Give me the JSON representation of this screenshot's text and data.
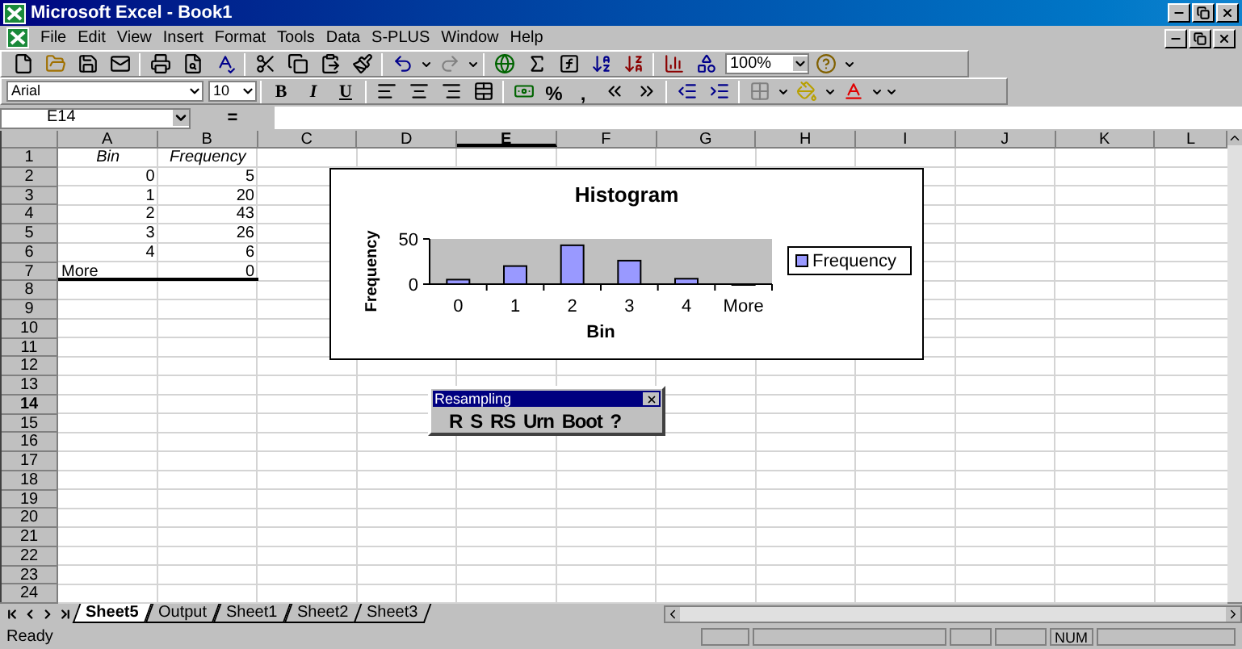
{
  "window": {
    "title": "Microsoft Excel - Book1"
  },
  "menu": [
    {
      "label": "File"
    },
    {
      "label": "Edit"
    },
    {
      "label": "View"
    },
    {
      "label": "Insert"
    },
    {
      "label": "Format"
    },
    {
      "label": "Tools"
    },
    {
      "label": "Data"
    },
    {
      "label": "S-PLUS"
    },
    {
      "label": "Window"
    },
    {
      "label": "Help"
    }
  ],
  "toolbar": {
    "zoom": "100%"
  },
  "format_toolbar": {
    "font": "Arial",
    "size": "10",
    "style_buttons": [
      "B",
      "I",
      "U"
    ],
    "number_buttons": [
      "%",
      ","
    ]
  },
  "formula_bar": {
    "name_box": "E14",
    "equals": "="
  },
  "columns": [
    {
      "label": "A",
      "selected": false
    },
    {
      "label": "B",
      "selected": false
    },
    {
      "label": "C",
      "selected": false
    },
    {
      "label": "D",
      "selected": false
    },
    {
      "label": "E",
      "selected": true
    },
    {
      "label": "F",
      "selected": false
    },
    {
      "label": "G",
      "selected": false
    },
    {
      "label": "H",
      "selected": false
    },
    {
      "label": "I",
      "selected": false
    },
    {
      "label": "J",
      "selected": false
    },
    {
      "label": "K",
      "selected": false
    },
    {
      "label": "L",
      "selected": false
    }
  ],
  "rows": [
    {
      "number": "1",
      "selected": false,
      "underlined": false,
      "cells": [
        {
          "text": "Bin",
          "kind": "label"
        },
        {
          "text": "Frequency",
          "kind": "label"
        }
      ]
    },
    {
      "number": "2",
      "selected": false,
      "underlined": false,
      "cells": [
        {
          "text": "0",
          "kind": "number"
        },
        {
          "text": "5",
          "kind": "number"
        }
      ]
    },
    {
      "number": "3",
      "selected": false,
      "underlined": false,
      "cells": [
        {
          "text": "1",
          "kind": "number"
        },
        {
          "text": "20",
          "kind": "number"
        }
      ]
    },
    {
      "number": "4",
      "selected": false,
      "underlined": false,
      "cells": [
        {
          "text": "2",
          "kind": "number"
        },
        {
          "text": "43",
          "kind": "number"
        }
      ]
    },
    {
      "number": "5",
      "selected": false,
      "underlined": false,
      "cells": [
        {
          "text": "3",
          "kind": "number"
        },
        {
          "text": "26",
          "kind": "number"
        }
      ]
    },
    {
      "number": "6",
      "selected": false,
      "underlined": false,
      "cells": [
        {
          "text": "4",
          "kind": "number"
        },
        {
          "text": "6",
          "kind": "number"
        }
      ]
    },
    {
      "number": "7",
      "selected": false,
      "underlined": true,
      "cells": [
        {
          "text": "More",
          "kind": "text"
        },
        {
          "text": "0",
          "kind": "number"
        }
      ]
    },
    {
      "number": "8",
      "selected": false,
      "underlined": false,
      "cells": []
    },
    {
      "number": "9",
      "selected": false,
      "underlined": false,
      "cells": []
    },
    {
      "number": "10",
      "selected": false,
      "underlined": false,
      "cells": []
    },
    {
      "number": "11",
      "selected": false,
      "underlined": false,
      "cells": []
    },
    {
      "number": "12",
      "selected": false,
      "underlined": false,
      "cells": []
    },
    {
      "number": "13",
      "selected": false,
      "underlined": false,
      "cells": []
    },
    {
      "number": "14",
      "selected": true,
      "underlined": false,
      "cells": []
    },
    {
      "number": "15",
      "selected": false,
      "underlined": false,
      "cells": []
    },
    {
      "number": "16",
      "selected": false,
      "underlined": false,
      "cells": []
    },
    {
      "number": "17",
      "selected": false,
      "underlined": false,
      "cells": []
    },
    {
      "number": "18",
      "selected": false,
      "underlined": false,
      "cells": []
    },
    {
      "number": "19",
      "selected": false,
      "underlined": false,
      "cells": []
    },
    {
      "number": "20",
      "selected": false,
      "underlined": false,
      "cells": []
    },
    {
      "number": "21",
      "selected": false,
      "underlined": false,
      "cells": []
    },
    {
      "number": "22",
      "selected": false,
      "underlined": false,
      "cells": []
    },
    {
      "number": "23",
      "selected": false,
      "underlined": false,
      "cells": []
    },
    {
      "number": "24",
      "selected": false,
      "underlined": false,
      "cells": []
    }
  ],
  "chart": {
    "chart_data": {
      "type": "bar",
      "title": "Histogram",
      "xlabel": "Bin",
      "ylabel": "Frequency",
      "categories": [
        "0",
        "1",
        "2",
        "3",
        "4",
        "More"
      ],
      "series": [
        {
          "name": "Frequency",
          "color": "#9999ff",
          "values": [
            5,
            20,
            43,
            26,
            6,
            0
          ]
        }
      ],
      "ylim": [
        0,
        50
      ],
      "yticks": [
        0,
        50
      ]
    }
  },
  "resampling_toolbar": {
    "title": "Resampling",
    "buttons": [
      "R",
      "S",
      "RS",
      "Urn",
      "Boot",
      "?"
    ]
  },
  "sheet_tabs": [
    {
      "label": "Sheet5",
      "selected": true
    },
    {
      "label": "Output",
      "selected": false
    },
    {
      "label": "Sheet1",
      "selected": false
    },
    {
      "label": "Sheet2",
      "selected": false
    },
    {
      "label": "Sheet3",
      "selected": false
    }
  ],
  "status_bar": {
    "text": "Ready",
    "indicators": [
      "NUM"
    ]
  }
}
